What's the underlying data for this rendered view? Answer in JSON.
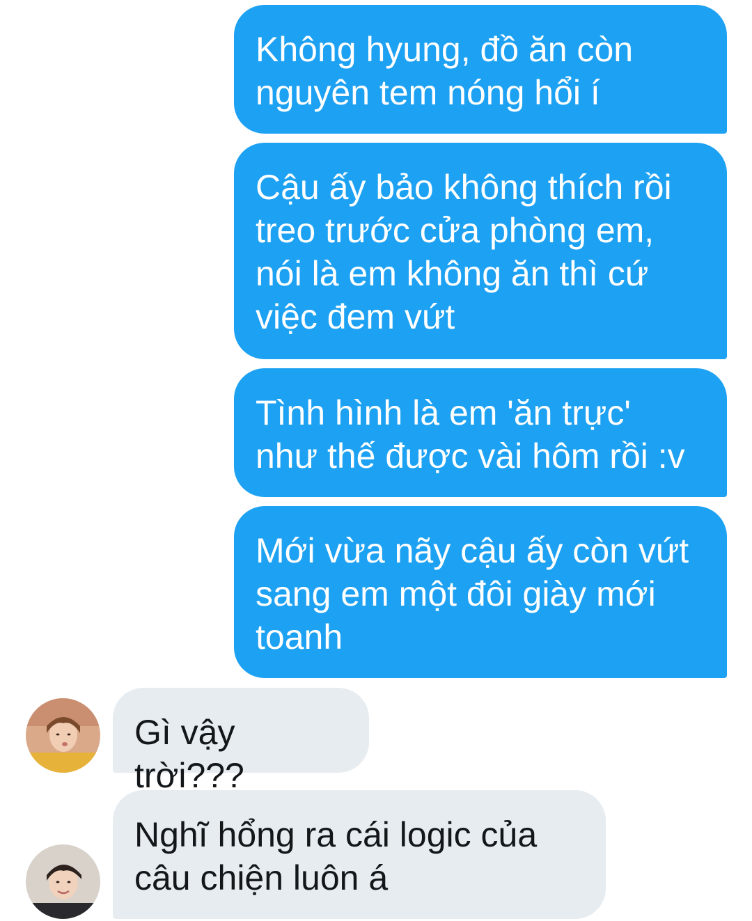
{
  "conversation": {
    "messages": [
      {
        "direction": "outgoing",
        "text": "Không hyung, đồ ăn còn\nnguyên tem nóng hổi í"
      },
      {
        "direction": "outgoing",
        "text": "Cậu ấy bảo không thích rồi\ntreo trước cửa phòng em,\nnói là em không ăn thì cứ\nviệc đem vứt"
      },
      {
        "direction": "outgoing",
        "text": "Tình hình là em 'ăn trực'\nnhư thế được vài hôm rồi :v"
      },
      {
        "direction": "outgoing",
        "text": "Mới vừa nãy cậu ấy còn vứt\nsang em một đôi giày mới\ntoanh"
      },
      {
        "direction": "incoming",
        "text": "Gì vậy trời???"
      },
      {
        "direction": "incoming",
        "text": "Nghĩ hổng ra cái logic của\ncâu chiện luôn á"
      }
    ]
  },
  "colors": {
    "outgoing_bubble": "#1da1f2",
    "outgoing_text": "#ffffff",
    "incoming_bubble": "#e6ecf0",
    "incoming_text": "#14171a"
  }
}
